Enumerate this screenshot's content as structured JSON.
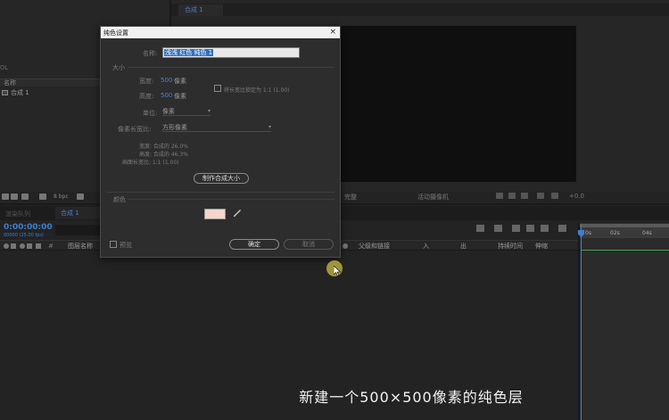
{
  "viewer": {
    "tab_label": "合成 1"
  },
  "project": {
    "left_label": "OL",
    "column_name": "名称",
    "item_name": "合成 1",
    "bpc": "8 bpc"
  },
  "viewer_toolbar": {
    "view_label": "完整",
    "camera_label": "活动摄像机",
    "offset": "+0.0"
  },
  "timeline": {
    "render_queue_tab": "渲染队列",
    "comp_tab": "合成 1",
    "timecode": "0:00:00:00",
    "timecode_sub": "00000 (25.00 fps)",
    "columns": {
      "layer_name": "图层名称",
      "parent": "父级和链接",
      "in": "入",
      "out": "出",
      "duration": "持续时间",
      "stretch": "伸缩"
    },
    "ruler": {
      "t0": "0s",
      "t2": "02s",
      "t4": "04s"
    }
  },
  "dialog": {
    "title": "纯色设置",
    "close_glyph": "×",
    "name_label": "名称:",
    "name_value": "浅浅 红色 纯色 1",
    "size_section": "大小",
    "width_label": "宽度:",
    "width_value": "500",
    "width_unit": "像素",
    "height_label": "高度:",
    "height_value": "500",
    "height_unit": "像素",
    "lock_aspect_label": "将长宽比锁定为 1:1 (1.00)",
    "units_label": "单位:",
    "units_value": "像素",
    "pixel_aspect_label": "像素长宽比:",
    "pixel_aspect_value": "方形像素",
    "info_width": "宽度: 合成的 26.0%",
    "info_height": "高度: 合成的 46.3%",
    "info_frame_aspect": "画面长宽比: 1:1 (1.00)",
    "make_comp_size": "制作合成大小",
    "color_section": "颜色",
    "color_value": "#f5d6cc",
    "preview_label": "预览",
    "ok_label": "确定",
    "cancel_label": "取消"
  },
  "subtitle": "新建一个500×500像素的纯色层"
}
